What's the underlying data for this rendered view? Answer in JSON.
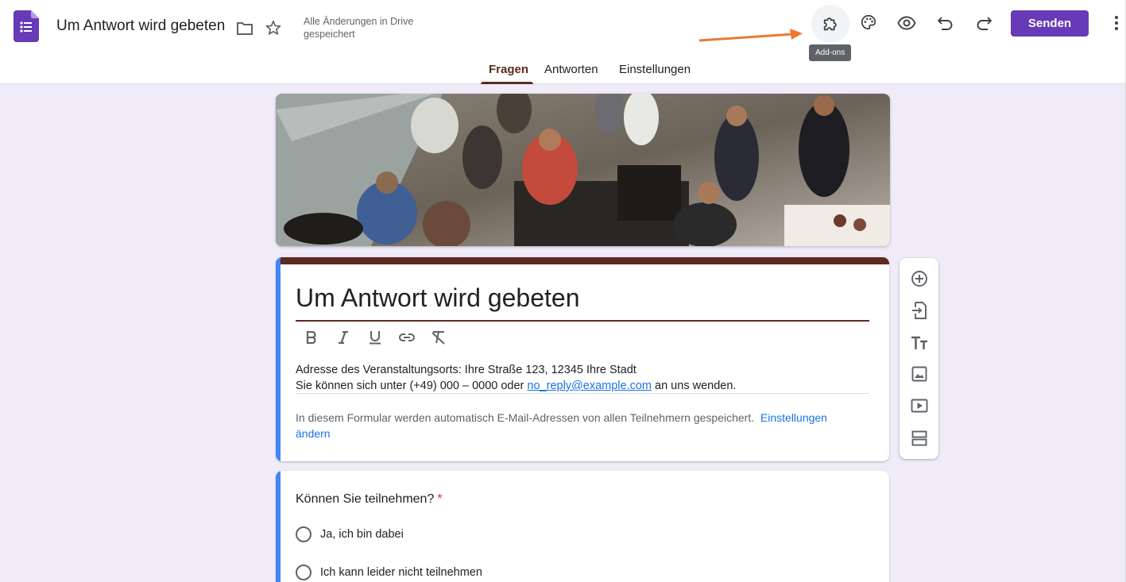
{
  "header": {
    "doc_title": "Um Antwort wird gebeten",
    "save_status": "Alle Änderungen in Drive gespeichert",
    "addons_tooltip": "Add-ons",
    "send_label": "Senden",
    "accent_color": "#673ab7",
    "icons": [
      "forms-logo-icon",
      "folder-icon",
      "star-icon",
      "puzzle-icon",
      "palette-icon",
      "eye-icon",
      "undo-icon",
      "redo-icon",
      "more-vert-icon"
    ]
  },
  "tabs": [
    {
      "label": "Fragen",
      "active": true
    },
    {
      "label": "Antworten",
      "active": false
    },
    {
      "label": "Einstellungen",
      "active": false
    }
  ],
  "form": {
    "title": "Um Antwort wird gebeten",
    "theme_color": "#5d2a22",
    "format_tools": [
      "bold-icon",
      "italic-icon",
      "underline-icon",
      "link-icon",
      "clear-format-icon"
    ],
    "description_line1": "Adresse des Veranstaltungsorts: Ihre Straße 123, 12345 Ihre Stadt",
    "description_line2_prefix": "Sie können sich unter (+49) 000 – 0000 oder ",
    "description_email": "no_reply@example.com",
    "description_line2_suffix": " an uns wenden.",
    "email_note": "In diesem Formular werden automatisch E-Mail-Adressen von allen Teilnehmern gespeichert.",
    "email_note_link": "Einstellungen ändern"
  },
  "side_toolbar": [
    "add-question-icon",
    "import-questions-icon",
    "add-title-icon",
    "add-image-icon",
    "add-video-icon",
    "add-section-icon"
  ],
  "question": {
    "title": "Können Sie teilnehmen?",
    "required_mark": "*",
    "options": [
      "Ja, ich bin dabei",
      "Ich kann leider nicht teilnehmen"
    ]
  }
}
